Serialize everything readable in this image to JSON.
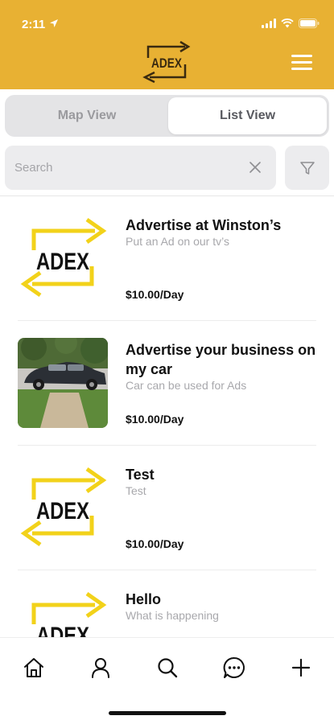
{
  "status": {
    "time": "2:11"
  },
  "header": {
    "logo_text": "ADEX"
  },
  "segment": {
    "map_label": "Map View",
    "list_label": "List View",
    "selected": "List View"
  },
  "search": {
    "placeholder": "Search",
    "value": ""
  },
  "listings": [
    {
      "title": "Advertise at Winston’s",
      "subtitle": "Put an Ad  on our tv’s",
      "price": "$10.00/Day",
      "image": "adex-logo"
    },
    {
      "title": "Advertise your business on my car",
      "subtitle": "Car can be used for Ads",
      "price": "$10.00/Day",
      "image": "car-photo"
    },
    {
      "title": "Test",
      "subtitle": "Test",
      "price": "$10.00/Day",
      "image": "adex-logo"
    },
    {
      "title": "Hello",
      "subtitle": "What is happening",
      "price": "",
      "image": "adex-logo"
    }
  ],
  "logo_text": "ADEX",
  "tabbar": {
    "icons": [
      "home-icon",
      "profile-icon",
      "search-icon",
      "chat-icon",
      "plus-icon"
    ]
  },
  "colors": {
    "header": "#e8b133",
    "logo_yellow": "#f2d21a"
  }
}
